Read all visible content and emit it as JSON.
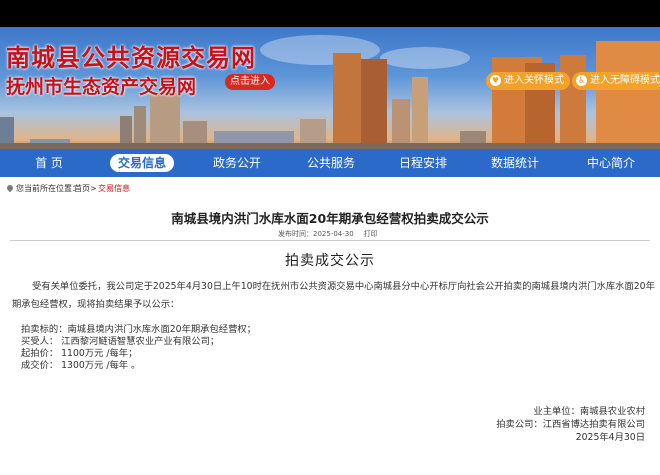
{
  "banner": {
    "title_main": "南城县公共资源交易网",
    "title_sub": "抚州市生态资产交易网",
    "enter_label": "点击进入",
    "care_mode_label": "进入关怀模式",
    "barrier_free_label": "进入无障碍模式"
  },
  "nav": {
    "items": [
      {
        "label": "首  页"
      },
      {
        "label": "交易信息"
      },
      {
        "label": "政务公开"
      },
      {
        "label": "公共服务"
      },
      {
        "label": "日程安排"
      },
      {
        "label": "数据统计"
      },
      {
        "label": "中心简介"
      }
    ],
    "active_index": 1
  },
  "breadcrumb": {
    "prefix": "您当前所在位置：",
    "home": "首页",
    "sep": ">",
    "level1": "交易信息"
  },
  "article": {
    "title": "南城县境内洪门水库水面20年期承包经营权拍卖成交公示",
    "date_label": "发布时间：",
    "date": "2025-04-30",
    "print_label": "打印",
    "notice_heading": "拍卖成交公示",
    "intro": "受有关单位委托，我公司定于2025年4月30日上午10时在抚州市公共资源交易中心南城县分中心开标厅向社会公开拍卖的南城县境内洪门水库水面20年期承包经营权，现将拍卖结果予以公示：",
    "items": [
      "拍卖标的：南城县境内洪门水库水面20年期承包经营权；",
      "买受人：  江西黎河鲢语智慧农业产业有限公司；",
      "起拍价：  1100万元 /每年；",
      "成交价：  1300万元 /每年 。"
    ],
    "signature": {
      "client_label": "业主单位：",
      "client": "南城县农业农村",
      "auction_label": "拍卖公司：",
      "auction_company": "江西省博达拍卖有限公司",
      "date": "2025年4月30日"
    }
  },
  "colors": {
    "brand_red": "#c4121a",
    "nav_blue": "#2b6ac8",
    "accent_orange": "#f2a22b"
  }
}
